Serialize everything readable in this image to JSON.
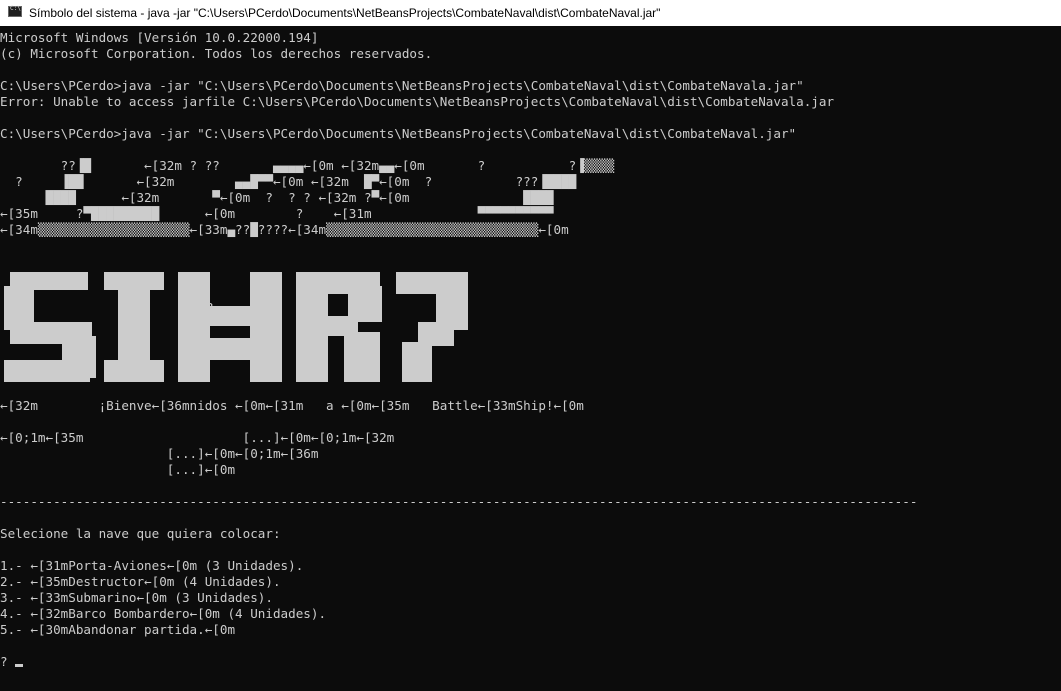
{
  "window": {
    "title": "Símbolo del sistema - java  -jar \"C:\\Users\\PCerdo\\Documents\\NetBeansProjects\\CombateNaval\\dist\\CombateNaval.jar\"",
    "icon": "command-prompt-icon"
  },
  "console": {
    "header": [
      "Microsoft Windows [Versión 10.0.22000.194]",
      "(c) Microsoft Corporation. Todos los derechos reservados."
    ],
    "command_1": "C:\\Users\\PCerdo>java -jar \"C:\\Users\\PCerdo\\Documents\\NetBeansProjects\\CombateNaval\\dist\\CombateNavala.jar\"",
    "error_1": "Error: Unable to access jarfile C:\\Users\\PCerdo\\Documents\\NetBeansProjects\\CombateNaval\\dist\\CombateNavala.jar",
    "command_2": "C:\\Users\\PCerdo>java -jar \"C:\\Users\\PCerdo\\Documents\\NetBeansProjects\\CombateNaval\\dist\\CombateNaval.jar\"",
    "ascii_art": [
      "        ??▐█       ←[32m ? ??       ▄▄▄▄←[0m ←[32m▄▄←[0m       ?           ?▐▒▒▒▒",
      "  ?     ▐██       ←[32m        ▄▄█▀▀←[0m ←[32m  █▀←[0m  ?           ???▐████",
      "      ████      ←[32m       ▀←[0m  ?  ? ? ←[32m ?▀←[0m               ████",
      "←[35m     ?▀█████████      ←[0m        ?    ←[31m              ▀▀▀▀▀▀▀▀▀▀",
      "←[34m▒▒▒▒▒▒▒▒▒▒▒▒▒▒▒▒▒▒▒▒←[33m▄??█????←[34m▒▒▒▒▒▒▒▒▒▒▒▒▒▒▒▒▒▒▒▒▒▒▒▒▒▒▒▒←[0m"
    ],
    "banner_glyph": "?",
    "welcome": "←[32m        ¡Bienve←[36mnidos ←[0m←[31m   a ←[0m←[35m   Battle←[33mShip!←[0m",
    "sub_lines": [
      "←[0;1m←[35m                     [...]←[0m←[0;1m←[32m",
      "                      [...]←[0m←[0;1m←[36m",
      "                      [...]←[0m"
    ],
    "separator": "-------------------------------------------------------------------------------------------------------------------------",
    "prompt_title": "Selecione la nave que quiera colocar:",
    "menu_options": [
      "1.- ←[31mPorta-Aviones←[0m (3 Unidades).",
      "2.- ←[35mDestructor←[0m (4 Unidades).",
      "3.- ←[33mSubmarino←[0m (3 Unidades).",
      "4.- ←[32mBarco Bombardero←[0m (4 Unidades).",
      "5.- ←[30mAbandonar partida.←[0m"
    ],
    "input_prompt": "?"
  },
  "colors": {
    "background": "#0c0c0c",
    "foreground": "#cccccc",
    "titlebar": "#ffffff"
  }
}
